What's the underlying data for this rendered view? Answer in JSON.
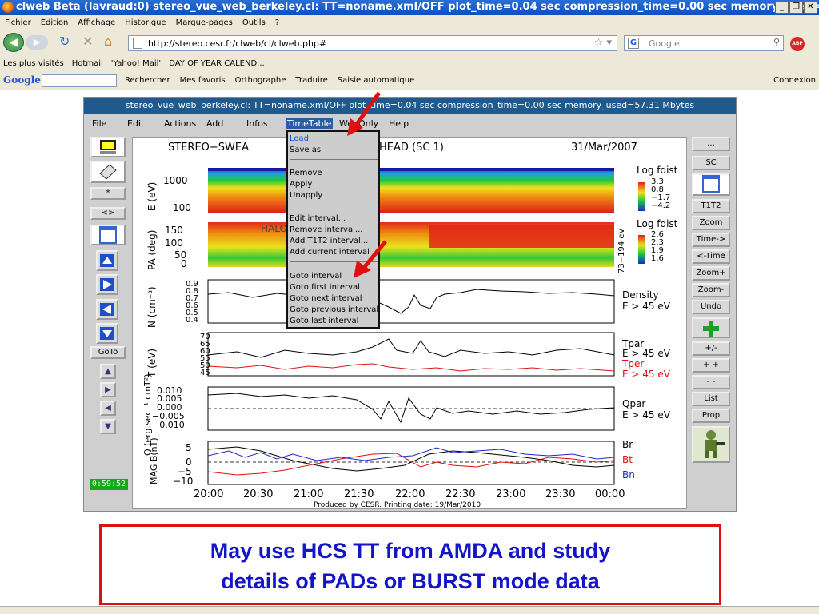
{
  "window": {
    "title": "clweb Beta (lavraud:0)  stereo_vue_web_berkeley.cl:   TT=noname.xml/OFF  plot_time=0.04 sec  compression_time=0.00 sec  memory_used=..."
  },
  "browser": {
    "menu": [
      "Fichier",
      "Édition",
      "Affichage",
      "Historique",
      "Marque-pages",
      "Outils",
      "?"
    ],
    "url": "http://stereo.cesr.fr/clweb/cl/clweb.php#",
    "search_placeholder": "Google",
    "bookmarks": [
      "Les plus visités",
      "Hotmail",
      "'Yahoo! Mail'",
      "DAY OF YEAR CALEND..."
    ],
    "google_toolbar": {
      "logo": "Google",
      "items": [
        "Rechercher",
        "Mes favoris",
        "Orthographe",
        "Traduire",
        "Saisie automatique"
      ],
      "connexion": "Connexion"
    }
  },
  "app": {
    "title": "stereo_vue_web_berkeley.cl:   TT=noname.xml/OFF  plot_time=0.04 sec  compression_time=0.00 sec  memory_used=57.31 Mbytes",
    "menu": [
      "File",
      "Edit",
      "Actions",
      "Add",
      "Infos",
      "TimeTable",
      "WebOnly",
      "Help"
    ],
    "timetable_menu": {
      "group1": [
        "Load",
        "Save as"
      ],
      "group2": [
        "Remove",
        "Apply",
        "Unapply"
      ],
      "group3": [
        "Edit interval...",
        "Remove interval...",
        "Add T1T2 interval...",
        "Add current interval"
      ],
      "group4": [
        "Goto interval",
        "Goto first interval",
        "Goto next interval",
        "Goto previous interval",
        "Goto last interval"
      ]
    },
    "left_buttons": {
      "star": "*",
      "range": "<>",
      "goto": "GoTo"
    },
    "clock": "0:59:52",
    "right_buttons": [
      "...",
      "SC",
      "T1T2",
      "Zoom",
      "Time->",
      "<-Time",
      "Zoom+",
      "Zoom-",
      "Undo",
      "+/-",
      "+ +",
      "- -",
      "List",
      "Prop"
    ],
    "plot": {
      "header_left": "STEREO−SWEA",
      "header_mid": "HEAD (SC 1)",
      "header_right": "31/Mar/2007",
      "panel1": {
        "ylabel": "E (eV)",
        "ticks": [
          "1000",
          "100"
        ],
        "legend_title": "Log fdist",
        "legend_vals": [
          "3.3",
          "0.8",
          "−1.7",
          "−4.2"
        ]
      },
      "panel2": {
        "ylabel": "PA (deg)",
        "ticks": [
          "150",
          "100",
          "50",
          "0"
        ],
        "legend_title": "Log fdist",
        "legend_vals": [
          "2.6",
          "2.3",
          "1.9",
          "1.6"
        ],
        "side_label": "73−194 eV",
        "overlay": "HALO"
      },
      "panel3": {
        "ylabel": "N (cm⁻³)",
        "ticks": [
          "0.9",
          "0.8",
          "0.7",
          "0.6",
          "0.5",
          "0.4"
        ],
        "labels": [
          "Density",
          "E > 45 eV"
        ]
      },
      "panel4": {
        "ylabel": "T (eV)",
        "ticks": [
          "70",
          "65",
          "60",
          "55",
          "50",
          "45"
        ],
        "labels": [
          "Tpar",
          "E > 45 eV",
          "Tper",
          "E > 45 eV"
        ]
      },
      "panel5": {
        "ylabel": "Q (erg.sec⁻¹.cmT²)",
        "ticks": [
          "0.010",
          "0.005",
          "0.000",
          "−0.005",
          "−0.010"
        ],
        "labels": [
          "Qpar",
          "E > 45 eV"
        ]
      },
      "panel6": {
        "ylabel": "MAG B(nT)",
        "ticks": [
          "5",
          "0",
          "−5",
          "−10"
        ],
        "labels": [
          "Br",
          "Bt",
          "Bn"
        ]
      },
      "xticks": [
        "20:00",
        "20:30",
        "21:00",
        "21:30",
        "22:00",
        "22:30",
        "23:00",
        "23:30",
        "00:00"
      ],
      "footer": "Produced by CESR.   Printing date: 19/Mar/2010"
    }
  },
  "caption": {
    "line1": "May use HCS TT from AMDA and study",
    "line2": "details of PADs or BURST mode data"
  },
  "colors": {
    "title_blue": "#1e5a8e",
    "caption_text": "#1414c8",
    "caption_border": "#e01010",
    "clock_green": "#16a816"
  }
}
